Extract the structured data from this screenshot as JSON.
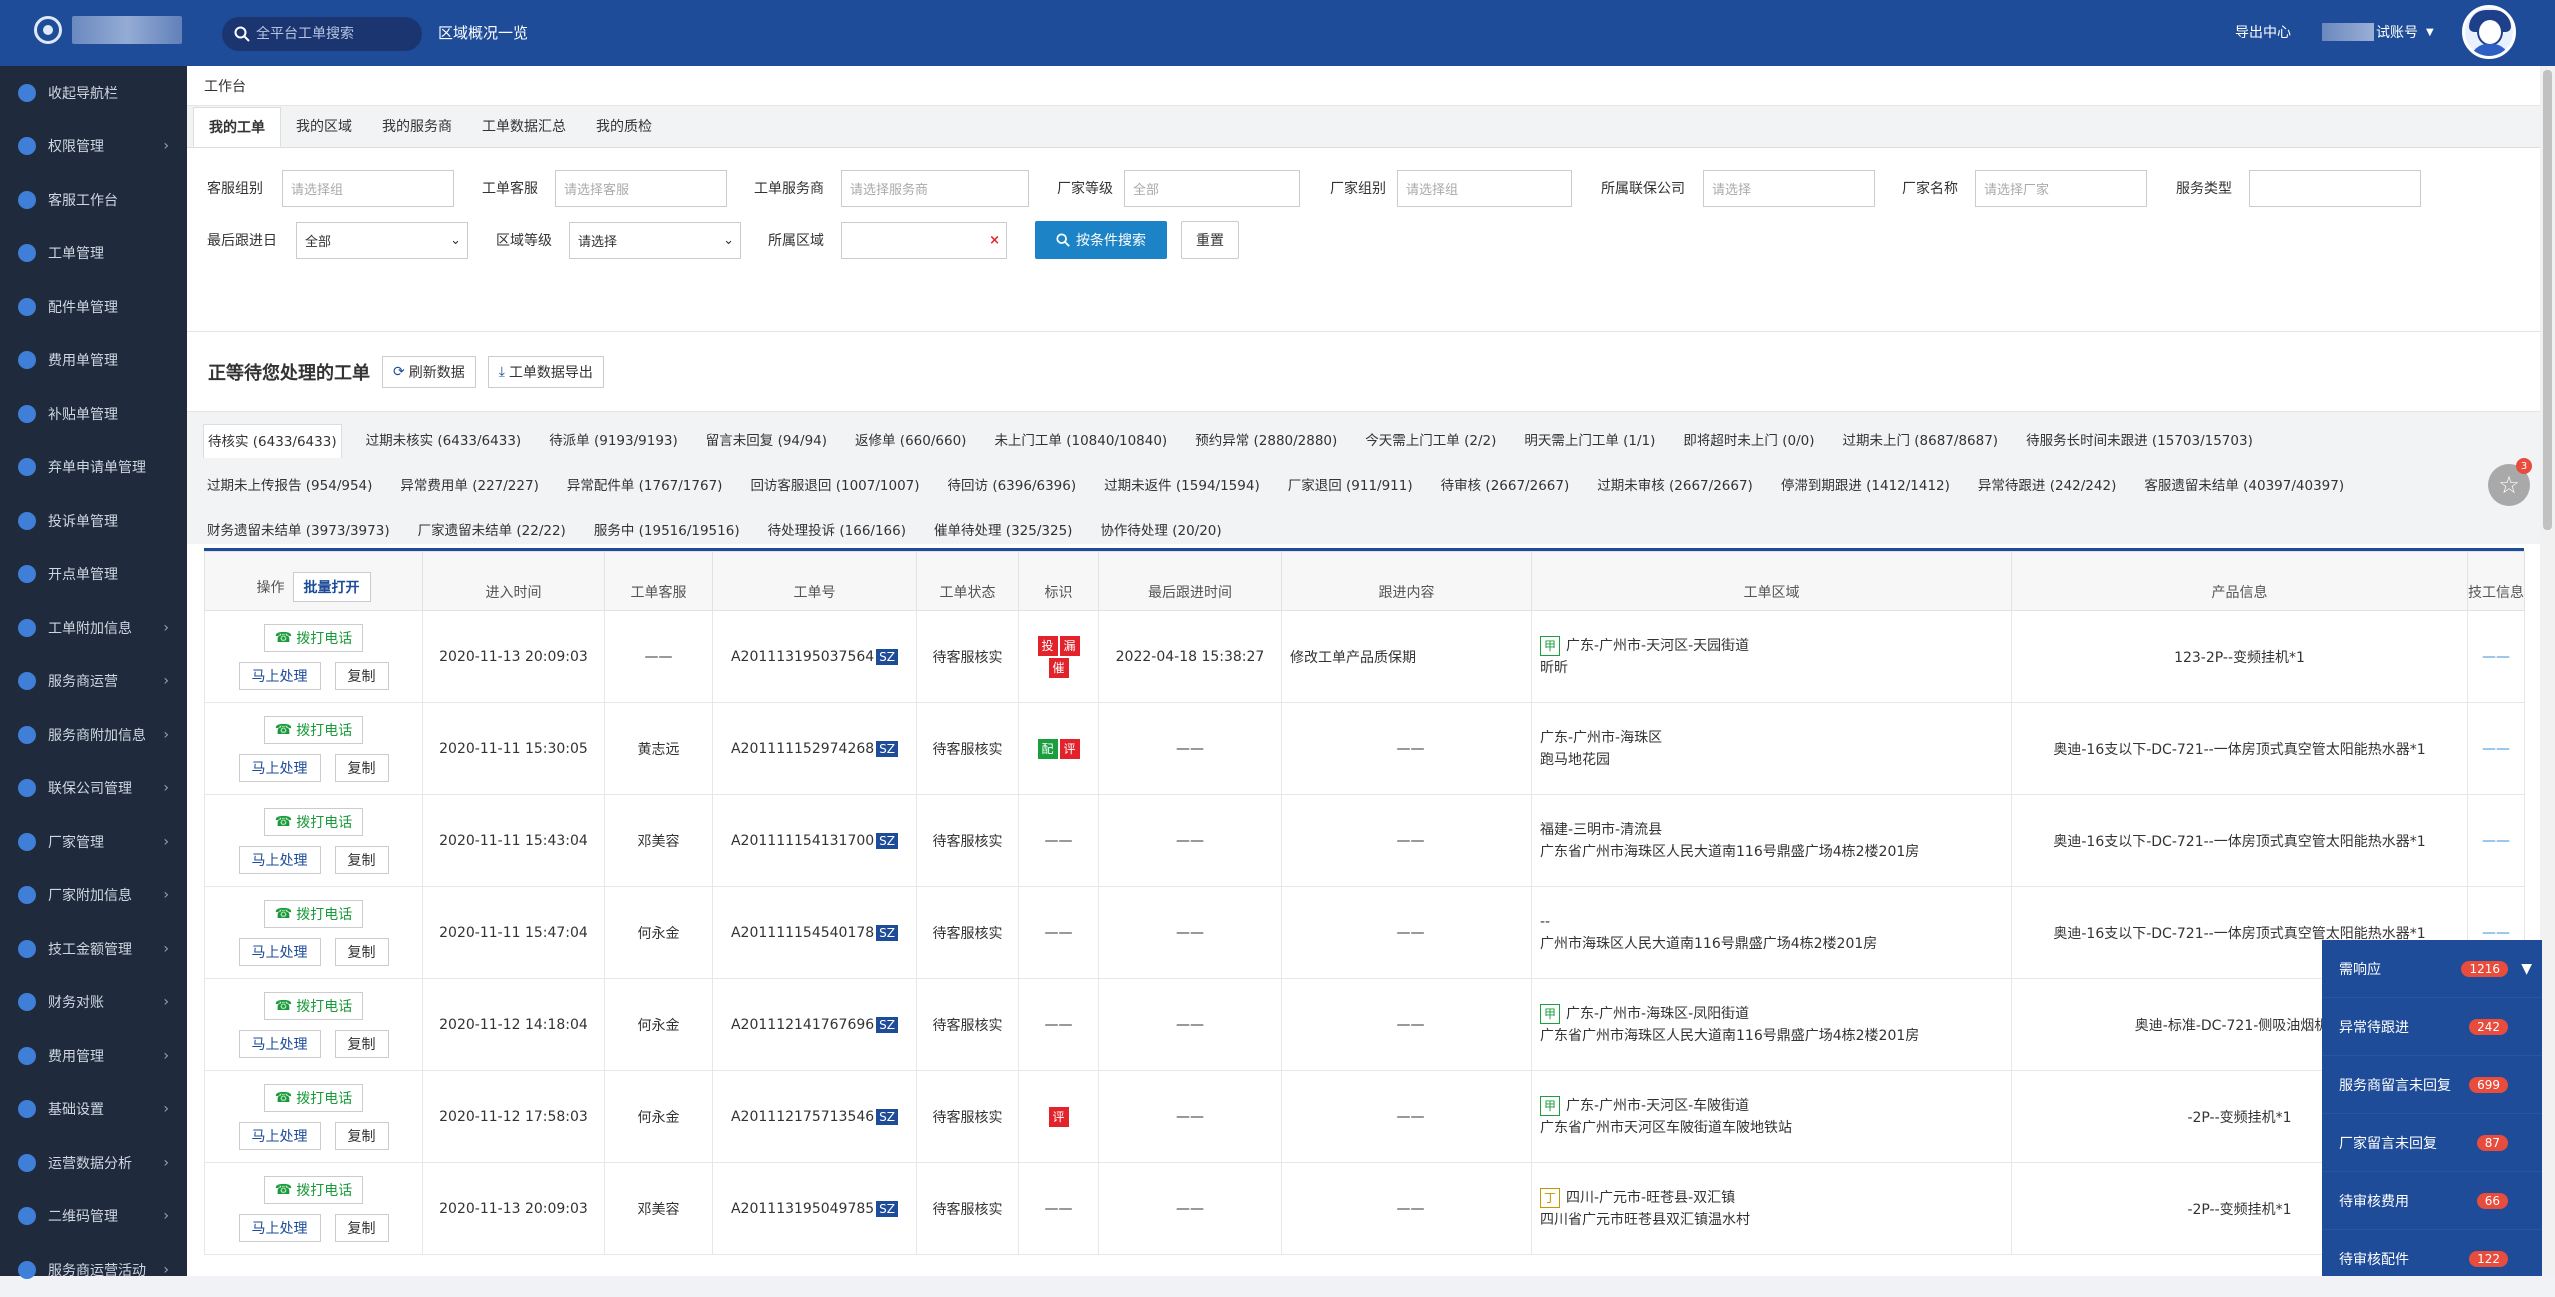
{
  "topbar": {
    "search_placeholder": "全平台工单搜索",
    "region_overview": "区域概况一览",
    "export_center": "导出中心",
    "account_suffix": "试账号"
  },
  "sidebar": {
    "items": [
      {
        "label": "收起导航栏",
        "icon": "collapse-icon"
      },
      {
        "label": "权限管理",
        "icon": "shield-icon",
        "arrow": true
      },
      {
        "label": "客服工作台",
        "icon": "headset-icon"
      },
      {
        "label": "工单管理",
        "icon": "search-icon"
      },
      {
        "label": "配件单管理",
        "icon": "parts-icon"
      },
      {
        "label": "费用单管理",
        "icon": "fee-icon"
      },
      {
        "label": "补贴单管理",
        "icon": "subsidy-icon"
      },
      {
        "label": "弃单申请单管理",
        "icon": "abandon-icon"
      },
      {
        "label": "投诉单管理",
        "icon": "complaint-icon"
      },
      {
        "label": "开点单管理",
        "icon": "open-point-icon"
      },
      {
        "label": "工单附加信息",
        "icon": "info-icon",
        "arrow": true
      },
      {
        "label": "服务商运营",
        "icon": "user-icon",
        "arrow": true
      },
      {
        "label": "服务商附加信息",
        "icon": "info-icon",
        "arrow": true
      },
      {
        "label": "联保公司管理",
        "icon": "company-icon",
        "arrow": true
      },
      {
        "label": "厂家管理",
        "icon": "factory-icon",
        "arrow": true
      },
      {
        "label": "厂家附加信息",
        "icon": "info-icon",
        "arrow": true
      },
      {
        "label": "技工金额管理",
        "icon": "yen-icon",
        "arrow": true
      },
      {
        "label": "财务对账",
        "icon": "finance-icon",
        "arrow": true
      },
      {
        "label": "费用管理",
        "icon": "fee-icon",
        "arrow": true
      },
      {
        "label": "基础设置",
        "icon": "gear-icon",
        "arrow": true
      },
      {
        "label": "运营数据分析",
        "icon": "chart-icon",
        "arrow": true
      },
      {
        "label": "二维码管理",
        "icon": "qrcode-icon",
        "arrow": true
      },
      {
        "label": "服务商运营活动",
        "icon": "activity-icon",
        "arrow": true
      }
    ]
  },
  "breadcrumb": "工作台",
  "tabs": [
    "我的工单",
    "我的区域",
    "我的服务商",
    "工单数据汇总",
    "我的质检"
  ],
  "filters": {
    "kefu_group": {
      "label": "客服组别",
      "placeholder": "请选择组"
    },
    "order_kefu": {
      "label": "工单客服",
      "placeholder": "请选择客服"
    },
    "order_provider": {
      "label": "工单服务商",
      "placeholder": "请选择服务商"
    },
    "factory_level": {
      "label": "厂家等级",
      "placeholder": "全部"
    },
    "factory_group": {
      "label": "厂家组别",
      "placeholder": "请选择组"
    },
    "warranty_company": {
      "label": "所属联保公司",
      "placeholder": "请选择"
    },
    "factory_name": {
      "label": "厂家名称",
      "placeholder": "请选择厂家"
    },
    "service_type": {
      "label": "服务类型",
      "placeholder": ""
    },
    "last_follow_date": {
      "label": "最后跟进日",
      "value": "全部"
    },
    "region_level": {
      "label": "区域等级",
      "value": "请选择"
    },
    "region": {
      "label": "所属区域"
    },
    "search_button": "按条件搜索",
    "reset_button": "重置"
  },
  "pending": {
    "title": "正等待您处理的工单",
    "refresh": "刷新数据",
    "export": "工单数据导出"
  },
  "status_rows": [
    [
      "待核实 (6433/6433)",
      "过期未核实 (6433/6433)",
      "待派单 (9193/9193)",
      "留言未回复 (94/94)",
      "返修单 (660/660)",
      "未上门工单 (10840/10840)",
      "预约异常 (2880/2880)",
      "今天需上门工单 (2/2)",
      "明天需上门工单 (1/1)",
      "即将超时未上门 (0/0)",
      "过期未上门 (8687/8687)",
      "待服务长时间未跟进 (15703/15703)"
    ],
    [
      "过期未上传报告 (954/954)",
      "异常费用单 (227/227)",
      "异常配件单 (1767/1767)",
      "回访客服退回 (1007/1007)",
      "待回访 (6396/6396)",
      "过期未返件 (1594/1594)",
      "厂家退回 (911/911)",
      "待审核 (2667/2667)",
      "过期未审核 (2667/2667)",
      "停滞到期跟进 (1412/1412)",
      "异常待跟进 (242/242)",
      "客服遗留未结单 (40397/40397)"
    ],
    [
      "财务遗留未结单 (3973/3973)",
      "厂家遗留未结单 (22/22)",
      "服务中 (19516/19516)",
      "待处理投诉 (166/166)",
      "催单待处理 (325/325)",
      "协作待处理 (20/20)"
    ]
  ],
  "star_badge": "3",
  "table": {
    "headers": {
      "op": "操作",
      "batch": "批量打开",
      "time": "进入时间",
      "kefu": "工单客服",
      "no": "工单号",
      "status": "工单状态",
      "mark": "标识",
      "follow_time": "最后跟进时间",
      "follow_content": "跟进内容",
      "area": "工单区域",
      "product": "产品信息",
      "tech": "技工信息"
    },
    "call_label": "拨打电话",
    "handle_label": "马上处理",
    "copy_label": "复制",
    "rows": [
      {
        "time": "2020-11-13 20:09:03",
        "kefu": "——",
        "no": "A201113195037564",
        "sz": "SZ",
        "status": "待客服核实",
        "tags": [
          {
            "t": "投",
            "c": "red"
          },
          {
            "t": "漏",
            "c": "red"
          },
          {
            "t": "催",
            "c": "red"
          }
        ],
        "follow_time": "2022-04-18 15:38:27",
        "follow_content": "修改工单产品质保期",
        "grade": "甲",
        "area1": "广东-广州市-天河区-天园街道",
        "area2": "昕昕",
        "product": "123-2P--变频挂机*1",
        "tech": "——"
      },
      {
        "time": "2020-11-11 15:30:05",
        "kefu": "黄志远",
        "no": "A201111152974268",
        "sz": "SZ",
        "status": "待客服核实",
        "tags": [
          {
            "t": "配",
            "c": "green"
          },
          {
            "t": "评",
            "c": "red"
          }
        ],
        "follow_time": "——",
        "follow_content": "——",
        "grade": "",
        "area1": "广东-广州市-海珠区",
        "area2": "跑马地花园",
        "product": "奥迪-16支以下-DC-721--一体房顶式真空管太阳能热水器*1",
        "tech": "——"
      },
      {
        "time": "2020-11-11 15:43:04",
        "kefu": "邓美容",
        "no": "A201111154131700",
        "sz": "SZ",
        "status": "待客服核实",
        "tags": [],
        "mark": "——",
        "follow_time": "——",
        "follow_content": "——",
        "grade": "",
        "area1": "福建-三明市-清流县",
        "area2": "广东省广州市海珠区人民大道南116号鼎盛广场4栋2楼201房",
        "product": "奥迪-16支以下-DC-721--一体房顶式真空管太阳能热水器*1",
        "tech": "——"
      },
      {
        "time": "2020-11-11 15:47:04",
        "kefu": "何永金",
        "no": "A201111154540178",
        "sz": "SZ",
        "status": "待客服核实",
        "tags": [],
        "mark": "——",
        "follow_time": "——",
        "follow_content": "——",
        "grade": "",
        "area1": "--",
        "area2": "广州市海珠区人民大道南116号鼎盛广场4栋2楼201房",
        "product": "奥迪-16支以下-DC-721--一体房顶式真空管太阳能热水器*1",
        "tech": "——"
      },
      {
        "time": "2020-11-12 14:18:04",
        "kefu": "何永金",
        "no": "A201112141767696",
        "sz": "SZ",
        "status": "待客服核实",
        "tags": [],
        "mark": "——",
        "follow_time": "——",
        "follow_content": "——",
        "grade": "甲",
        "area1": "广东-广州市-海珠区-凤阳街道",
        "area2": "广东省广州市海珠区人民大道南116号鼎盛广场4栋2楼201房",
        "product": "奥迪-标准-DC-721-侧吸油烟机*1",
        "tech": "——"
      },
      {
        "time": "2020-11-12 17:58:03",
        "kefu": "何永金",
        "no": "A201112175713546",
        "sz": "SZ",
        "status": "待客服核实",
        "tags": [
          {
            "t": "评",
            "c": "red"
          }
        ],
        "follow_time": "——",
        "follow_content": "——",
        "grade": "甲",
        "area1": "广东-广州市-天河区-车陂街道",
        "area2": "广东省广州市天河区车陂街道车陂地铁站",
        "product": "-2P--变频挂机*1",
        "tech": "——"
      },
      {
        "time": "2020-11-13 20:09:03",
        "kefu": "邓美容",
        "no": "A201113195049785",
        "sz": "SZ",
        "status": "待客服核实",
        "tags": [],
        "mark": "——",
        "follow_time": "——",
        "follow_content": "——",
        "grade": "丁",
        "area1": "四川-广元市-旺苍县-双汇镇",
        "area2": "四川省广元市旺苍县双汇镇温水村",
        "product": "-2P--变频挂机*1",
        "tech": "——"
      }
    ]
  },
  "float_panel": [
    {
      "label": "需响应",
      "count": "1216"
    },
    {
      "label": "异常待跟进",
      "count": "242"
    },
    {
      "label": "服务商留言未回复",
      "count": "699"
    },
    {
      "label": "厂家留言未回复",
      "count": "87"
    },
    {
      "label": "待审核费用",
      "count": "66"
    },
    {
      "label": "待审核配件",
      "count": "122"
    }
  ]
}
